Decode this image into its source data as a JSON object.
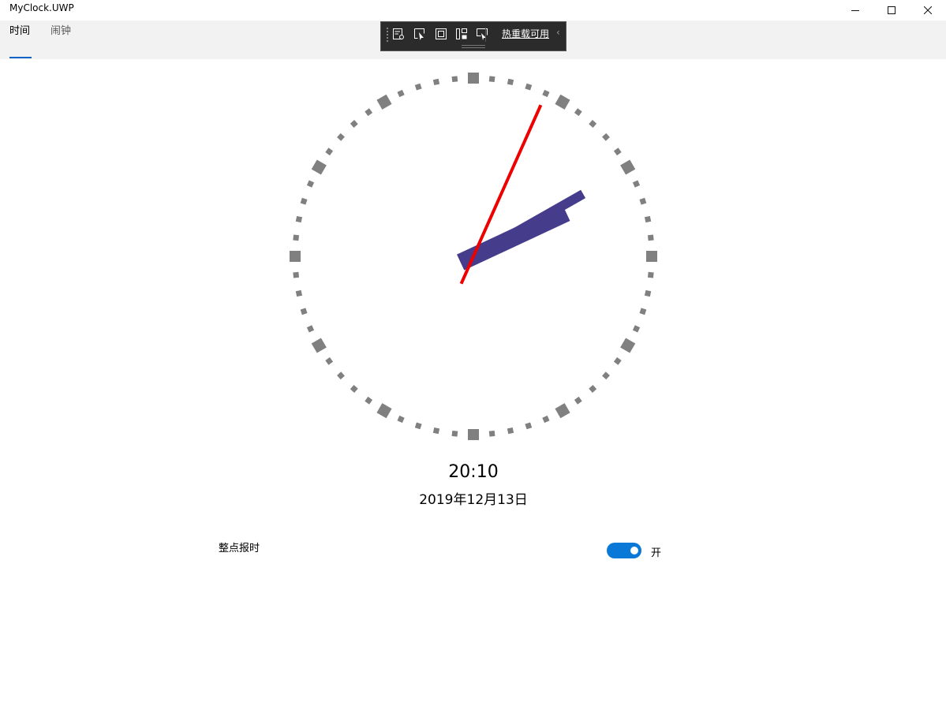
{
  "window": {
    "title": "MyClock.UWP",
    "controls": {
      "minimize": "minimize-icon",
      "maximize": "maximize-icon",
      "close": "close-icon"
    }
  },
  "nav": {
    "tabs": [
      {
        "label": "时间",
        "selected": true
      },
      {
        "label": "闹钟",
        "selected": false
      }
    ],
    "accent": "#0a64c8"
  },
  "hot_reload_toolbar": {
    "tools": [
      "live-visual-tree-icon",
      "select-element-icon",
      "display-layout-adorners-icon",
      "track-focus-icon",
      "binding-failures-icon"
    ],
    "label": "热重载可用",
    "collapse": "‹"
  },
  "clock": {
    "hour": 20,
    "minute": 10,
    "second": 4,
    "tick_color": "#808080",
    "hand_color": "#463c8c",
    "second_hand_color": "#ee0000"
  },
  "time_display": "20:10",
  "date_display": "2019年12月13日",
  "hourly_chime": {
    "label": "整点报时",
    "enabled": true,
    "state_text": "开",
    "toggle_color": "#0a78d7"
  }
}
